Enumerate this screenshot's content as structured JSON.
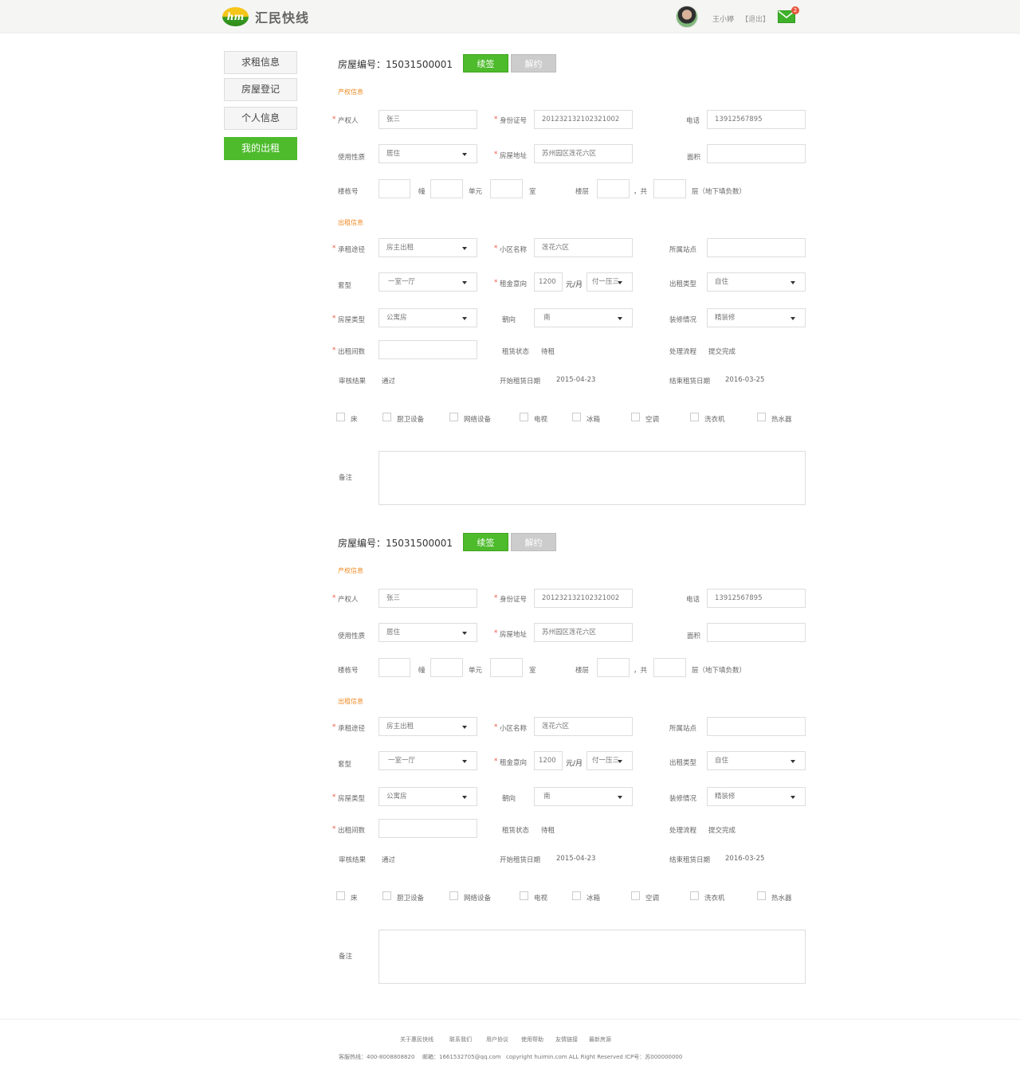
{
  "header": {
    "brand": "汇民快线",
    "logo_mark": "hm",
    "username": "王小婷",
    "logout": "【退出】",
    "mail_count": "2"
  },
  "sidebar": {
    "items": [
      {
        "label": "求租信息"
      },
      {
        "label": "房屋登记"
      },
      {
        "label": "个人信息"
      },
      {
        "label": "我的出租"
      }
    ]
  },
  "labels": {
    "house_no_prefix": "房屋编号：",
    "renew": "续签",
    "terminate": "解约",
    "property_section": "产权信息",
    "rental_section": "出租信息",
    "owner": "产权人",
    "id_no": "身份证号",
    "phone": "电话",
    "usage": "使用性质",
    "address": "房屋地址",
    "area": "面积",
    "building": "楼栋号",
    "dong": "幢",
    "unit": "单元",
    "room": "室",
    "floor": "楼层",
    "floor_total": "，共",
    "floor_suffix": "层（地下填负数）",
    "channel": "承租途径",
    "community": "小区名称",
    "station": "所属站点",
    "layout": "套型",
    "rent_intent": "租金意向",
    "rent_unit": "元/月",
    "rent_type": "出租类型",
    "house_type": "房屋类型",
    "orientation": "朝向",
    "decoration": "装修情况",
    "rent_rooms": "出租间数",
    "lease_status": "租赁状态",
    "process": "处理流程",
    "review": "审核结果",
    "start_date": "开始租赁日期",
    "end_date": "结束租赁日期",
    "remark": "备注"
  },
  "amenities": [
    "床",
    "厨卫设备",
    "网络设备",
    "电视",
    "冰箱",
    "空调",
    "洗衣机",
    "热水器"
  ],
  "listings": [
    {
      "house_no": "15031500001",
      "owner": "张三",
      "id_no": "201232132102321002",
      "phone": "13912567895",
      "usage": "居住",
      "address": "苏州园区莲花六区",
      "channel": "房主出租",
      "community": "莲花六区",
      "layout": "一室一厅",
      "rent": "1200",
      "payment": "付一压三",
      "rent_type": "自住",
      "house_type": "公寓房",
      "orientation": "南",
      "decoration": "精装修",
      "lease_status": "待租",
      "process": "提交完成",
      "review": "通过",
      "start_date": "2015-04-23",
      "end_date": "2016-03-25"
    },
    {
      "house_no": "15031500001",
      "owner": "张三",
      "id_no": "201232132102321002",
      "phone": "13912567895",
      "usage": "居住",
      "address": "苏州园区莲花六区",
      "channel": "房主出租",
      "community": "莲花六区",
      "layout": "一室一厅",
      "rent": "1200",
      "payment": "付一压三",
      "rent_type": "自住",
      "house_type": "公寓房",
      "orientation": "南",
      "decoration": "精装修",
      "lease_status": "待租",
      "process": "提交完成",
      "review": "通过",
      "start_date": "2015-04-23",
      "end_date": "2016-03-25"
    }
  ],
  "footer": {
    "links": [
      "关于惠民快线",
      "联系我们",
      "用户协议",
      "使用帮助",
      "友情链接",
      "最新房源"
    ],
    "hotline": "客服热线：400-8008808820",
    "email": "邮箱：1661532705@qq.com",
    "copyright": "copyright  huimin.com ALL Right Reserved ICP号：苏000000000"
  },
  "colors": {
    "accent_green": "#4dbb2c",
    "section_orange": "#f08a24",
    "required_red": "#e8543e"
  }
}
